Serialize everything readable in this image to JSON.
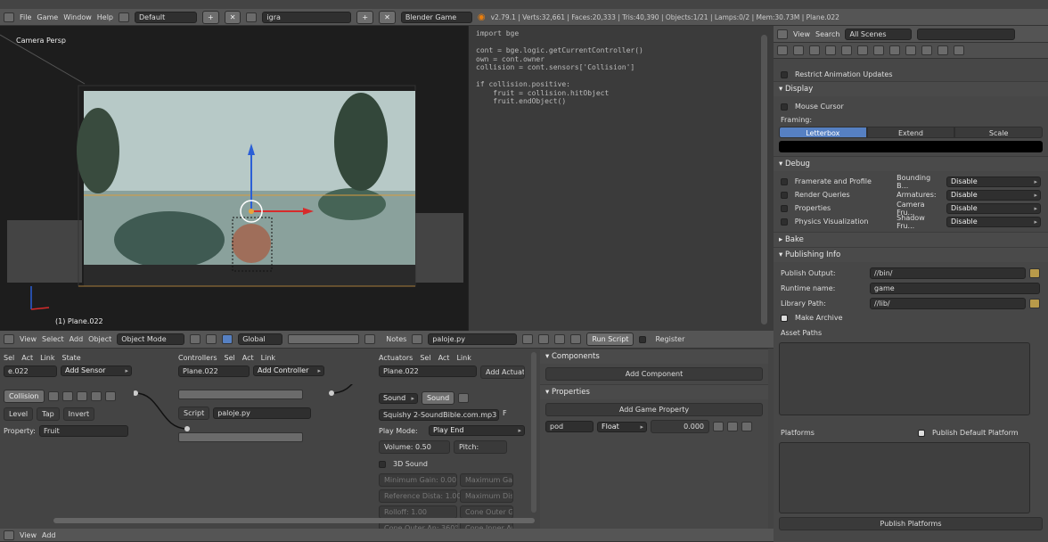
{
  "topbar": {
    "menu": [
      "File",
      "Game",
      "Window",
      "Help"
    ],
    "layout": "Default",
    "scene": "igra",
    "engine": "Blender Game",
    "stats": "v2.79.1 | Verts:32,661 | Faces:20,333 | Tris:40,390 | Objects:1/21 | Lamps:0/2 | Mem:30.73M | Plane.022"
  },
  "viewport": {
    "label": "Camera Persp",
    "object_label": "(1) Plane.022",
    "header": {
      "menu": [
        "View",
        "Select",
        "Add",
        "Object"
      ],
      "mode": "Object Mode",
      "orientation": "Global"
    }
  },
  "text_editor": {
    "code": "import bge\n\ncont = bge.logic.getCurrentController()\nown = cont.owner\ncollision = cont.sensors['Collision']\n\nif collision.positive:\n    fruit = collision.hitObject\n    fruit.endObject()",
    "header": {
      "notes": "Notes",
      "file": "paloje.py",
      "run": "Run Script",
      "register": "Register"
    }
  },
  "outliner_header": {
    "view": "View",
    "search": "Search",
    "scope": "All Scenes"
  },
  "properties": {
    "restrict": "Restrict Animation Updates",
    "display": {
      "title": "Display",
      "mouse_cursor": "Mouse Cursor",
      "framing": "Framing:",
      "framing_opts": [
        "Letterbox",
        "Extend",
        "Scale"
      ],
      "framing_active": "Letterbox"
    },
    "debug": {
      "title": "Debug",
      "rows": [
        {
          "left": "Framerate and Profile",
          "mid": "Bounding B...",
          "val": "Disable"
        },
        {
          "left": "Render Queries",
          "mid": "Armatures:",
          "val": "Disable"
        },
        {
          "left": "Properties",
          "mid": "Camera Fru...",
          "val": "Disable"
        },
        {
          "left": "Physics Visualization",
          "mid": "Shadow Fru...",
          "val": "Disable"
        }
      ]
    },
    "bake": "Bake",
    "publishing": {
      "title": "Publishing Info",
      "output_label": "Publish Output:",
      "output": "//bin/",
      "runtime_label": "Runtime name:",
      "runtime": "game",
      "library_label": "Library Path:",
      "library": "//lib/",
      "archive": "Make Archive",
      "asset_paths": "Asset Paths",
      "platforms": "Platforms",
      "publish_default": "Publish Default Platform",
      "publish_platforms": "Publish Platforms"
    }
  },
  "logic": {
    "sensors": {
      "toggles": [
        "Sel",
        "Act",
        "Link",
        "State"
      ],
      "object": "e.022",
      "add": "Add Sensor",
      "name": "Collision",
      "level": "Level",
      "tap": "Tap",
      "invert": "Invert",
      "property_label": "Property:",
      "property": "Fruit"
    },
    "controllers": {
      "title": "Controllers",
      "toggles": [
        "Sel",
        "Act",
        "Link"
      ],
      "object": "Plane.022",
      "add": "Add Controller",
      "script_label": "Script",
      "script": "paloje.py"
    },
    "actuators": {
      "title": "Actuators",
      "toggles": [
        "Sel",
        "Act",
        "Link"
      ],
      "object": "Plane.022",
      "add": "Add Actuator",
      "type": "Sound",
      "name": "Sound",
      "file": "Squishy 2-SoundBible.com.mp3",
      "file_f": "F",
      "play_mode_label": "Play Mode:",
      "play_mode": "Play End",
      "volume_label": "Volume:",
      "volume": "0.50",
      "pitch_label": "Pitch:",
      "sound3d": "3D Sound",
      "grid": [
        [
          "Minimum Gain: 0.00",
          "Maximum Gain"
        ],
        [
          "Reference Dista: 1.00",
          "Maximum Dista"
        ],
        [
          "Rolloff:",
          "1.00",
          "Cone Outer Ga"
        ],
        [
          "Cone Outer An: 360°",
          "Cone Inner An"
        ]
      ]
    },
    "components": {
      "title": "Components",
      "add": "Add Component",
      "properties_title": "Properties",
      "add_prop": "Add Game Property",
      "prop_name": "pod",
      "prop_type": "Float",
      "prop_value": "0.000"
    },
    "footer": {
      "view": "View",
      "add": "Add"
    }
  }
}
